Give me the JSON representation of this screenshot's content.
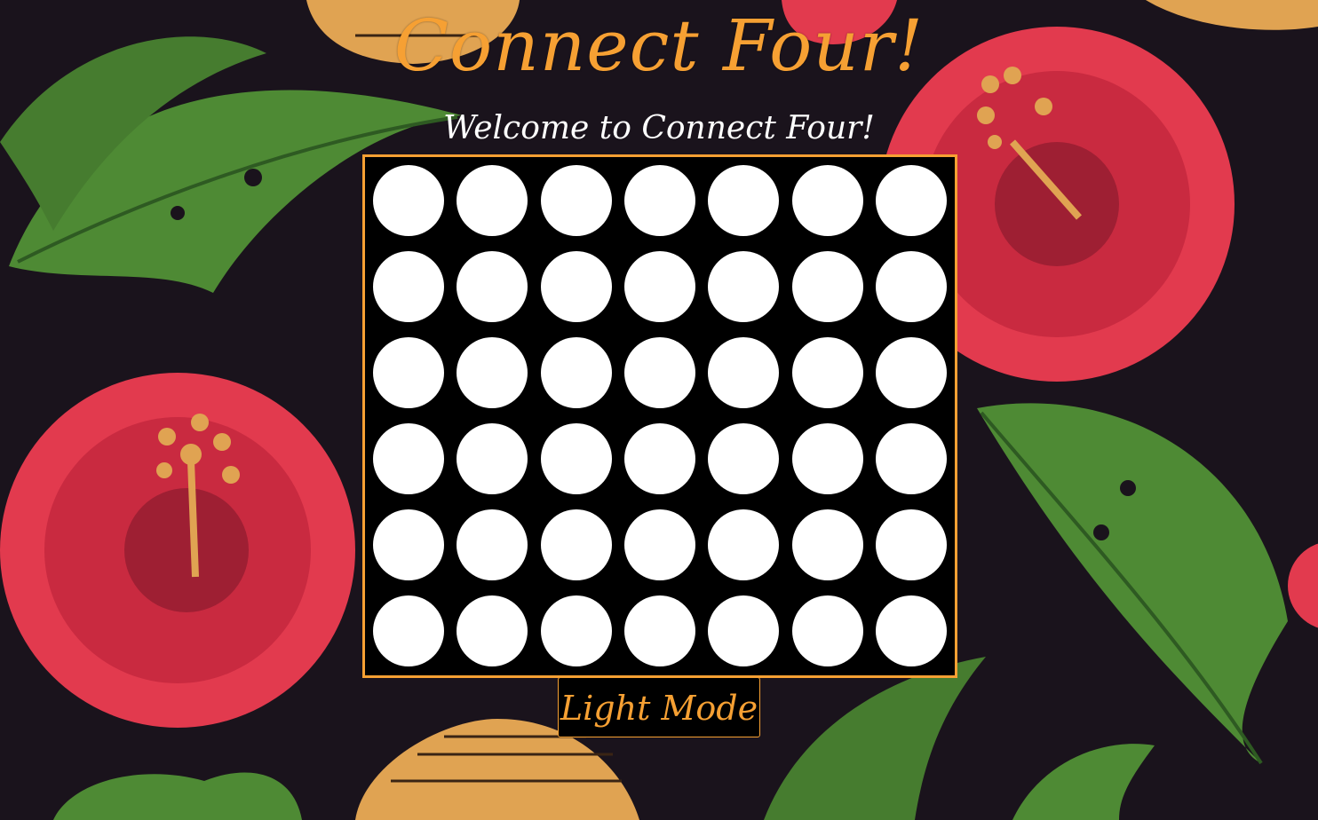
{
  "header": {
    "title": "Connect Four!",
    "welcome": "Welcome to Connect Four!"
  },
  "board": {
    "rows": 6,
    "columns": 7,
    "cells": [
      [
        "empty",
        "empty",
        "empty",
        "empty",
        "empty",
        "empty",
        "empty"
      ],
      [
        "empty",
        "empty",
        "empty",
        "empty",
        "empty",
        "empty",
        "empty"
      ],
      [
        "empty",
        "empty",
        "empty",
        "empty",
        "empty",
        "empty",
        "empty"
      ],
      [
        "empty",
        "empty",
        "empty",
        "empty",
        "empty",
        "empty",
        "empty"
      ],
      [
        "empty",
        "empty",
        "empty",
        "empty",
        "empty",
        "empty",
        "empty"
      ],
      [
        "empty",
        "empty",
        "empty",
        "empty",
        "empty",
        "empty",
        "empty"
      ]
    ]
  },
  "controls": {
    "mode_button_label": "Light Mode"
  },
  "colors": {
    "accent": "#f6a033",
    "page_background": "#1a131c",
    "board_background": "#000000",
    "empty_slot": "#ffffff",
    "hibiscus": "#e23a4e",
    "leaf": "#4e8a34",
    "pineapple": "#e0a352"
  }
}
